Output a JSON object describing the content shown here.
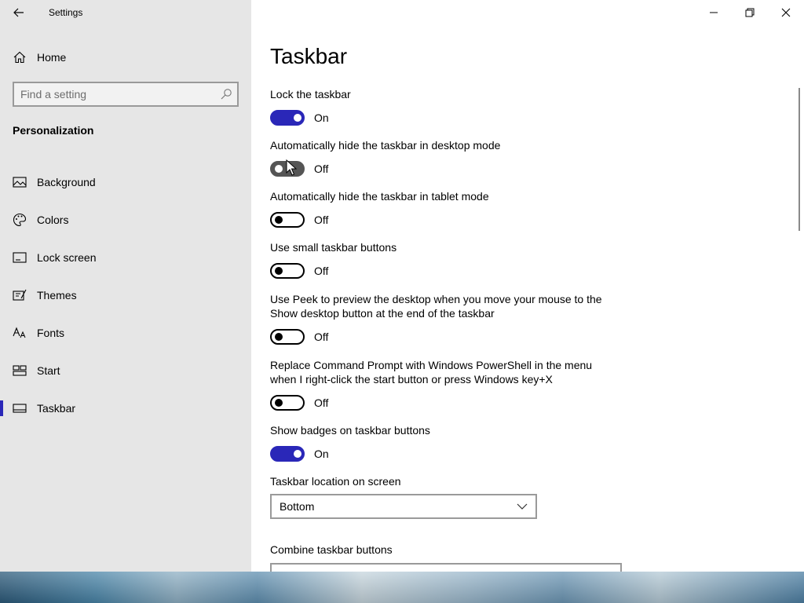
{
  "window": {
    "app_title": "Settings"
  },
  "sidebar": {
    "home_label": "Home",
    "search_placeholder": "Find a setting",
    "section_heading": "Personalization",
    "items": [
      {
        "label": "Background",
        "icon": "picture-icon"
      },
      {
        "label": "Colors",
        "icon": "palette-icon"
      },
      {
        "label": "Lock screen",
        "icon": "lock-screen-icon"
      },
      {
        "label": "Themes",
        "icon": "themes-icon"
      },
      {
        "label": "Fonts",
        "icon": "fonts-icon"
      },
      {
        "label": "Start",
        "icon": "start-icon"
      },
      {
        "label": "Taskbar",
        "icon": "taskbar-icon",
        "selected": true
      }
    ]
  },
  "main": {
    "title": "Taskbar",
    "settings": [
      {
        "label": "Lock the taskbar",
        "state": "On"
      },
      {
        "label": "Automatically hide the taskbar in desktop mode",
        "state": "Off"
      },
      {
        "label": "Automatically hide the taskbar in tablet mode",
        "state": "Off"
      },
      {
        "label": "Use small taskbar buttons",
        "state": "Off"
      },
      {
        "label": "Use Peek to preview the desktop when you move your mouse to the Show desktop button at the end of the taskbar",
        "state": "Off"
      },
      {
        "label": "Replace Command Prompt with Windows PowerShell in the menu when I right-click the start button or press Windows key+X",
        "state": "Off"
      },
      {
        "label": "Show badges on taskbar buttons",
        "state": "On"
      }
    ],
    "location_label": "Taskbar location on screen",
    "location_value": "Bottom",
    "combine_label": "Combine taskbar buttons"
  },
  "colors": {
    "accent": "#2a27b8",
    "sidebar_bg": "#e6e6e6"
  }
}
